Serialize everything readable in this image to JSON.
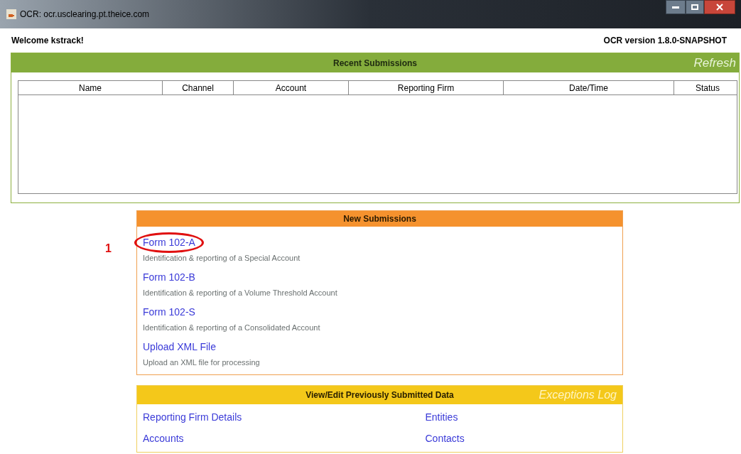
{
  "window": {
    "title": "OCR: ocr.usclearing.pt.theice.com"
  },
  "header": {
    "welcome": "Welcome kstrack!",
    "version": "OCR version 1.8.0-SNAPSHOT"
  },
  "recent_submissions": {
    "title": "Recent Submissions",
    "action": "Refresh",
    "table": {
      "columns": [
        "Name",
        "Channel",
        "Account",
        "Reporting Firm",
        "Date/Time",
        "Status"
      ]
    }
  },
  "new_submissions": {
    "title": "New Submissions",
    "callout": {
      "label": "1"
    },
    "items": [
      {
        "link": "Form 102-A",
        "description": "Identification & reporting of a Special Account",
        "highlighted": true
      },
      {
        "link": "Form 102-B",
        "description": "Identification & reporting of a Volume Threshold Account",
        "highlighted": false
      },
      {
        "link": "Form 102-S",
        "description": "Identification & reporting of a Consolidated Account",
        "highlighted": false
      },
      {
        "link": "Upload XML File",
        "description": "Upload an XML file for processing",
        "highlighted": false
      }
    ]
  },
  "view_edit": {
    "title": "View/Edit Previously Submitted Data",
    "action": "Exceptions Log",
    "links": [
      "Reporting Firm Details",
      "Entities",
      "Accounts",
      "Contacts"
    ]
  }
}
